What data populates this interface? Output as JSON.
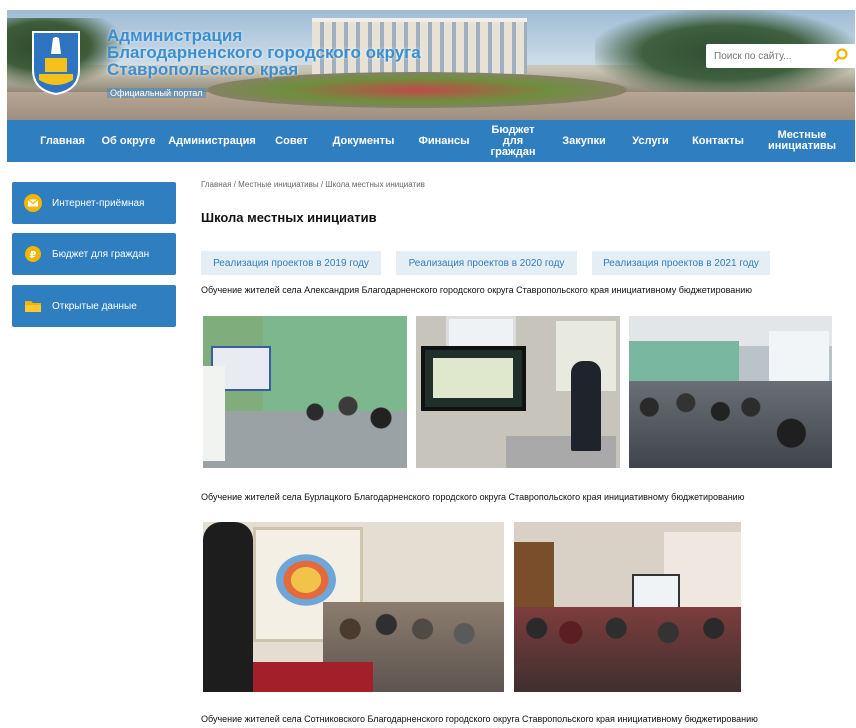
{
  "header": {
    "title_lines": [
      "Администрация",
      "Благодарненского городского округа",
      "Ставропольского края"
    ],
    "subtitle": "Официальный портал",
    "search_placeholder": "Поиск по сайту..."
  },
  "nav": {
    "items": [
      {
        "label": "Главная"
      },
      {
        "label": "Об округе"
      },
      {
        "label": "Администрация"
      },
      {
        "label": "Совет"
      },
      {
        "label": "Документы"
      },
      {
        "label": "Финансы"
      },
      {
        "label": "Бюджет для граждан"
      },
      {
        "label": "Закупки"
      },
      {
        "label": "Услуги"
      },
      {
        "label": "Контакты"
      },
      {
        "label": "Местные инициативы"
      }
    ]
  },
  "sidebar": {
    "items": [
      {
        "label": "Интернет-приёмная",
        "icon": "envelope-icon"
      },
      {
        "label": "Бюджет для граждан",
        "icon": "coin-icon"
      },
      {
        "label": "Открытые данные",
        "icon": "folder-icon"
      }
    ],
    "accent_color": "#2f7ec0",
    "icon_color": "#f5b400"
  },
  "main": {
    "breadcrumb": "Главная / Местные инициативы / Школа местных инициатив",
    "title": "Школа местных инициатив",
    "tabs": [
      {
        "label": "Реализация проектов в 2019 году"
      },
      {
        "label": "Реализация проектов в 2020 году"
      },
      {
        "label": "Реализация проектов в 2021 году"
      }
    ],
    "captions": [
      "Обучение жителей села Александрия Благодарненского городского округа Ставропольского края инициативному бюджетированию",
      "Обучение жителей села Бурлацкого Благодарненского городского округа Ставропольского края инициативному бюджетированию",
      "Обучение жителей села Сотниковского Благодарненского городского округа Ставропольского края инициативному бюджетированию"
    ]
  }
}
